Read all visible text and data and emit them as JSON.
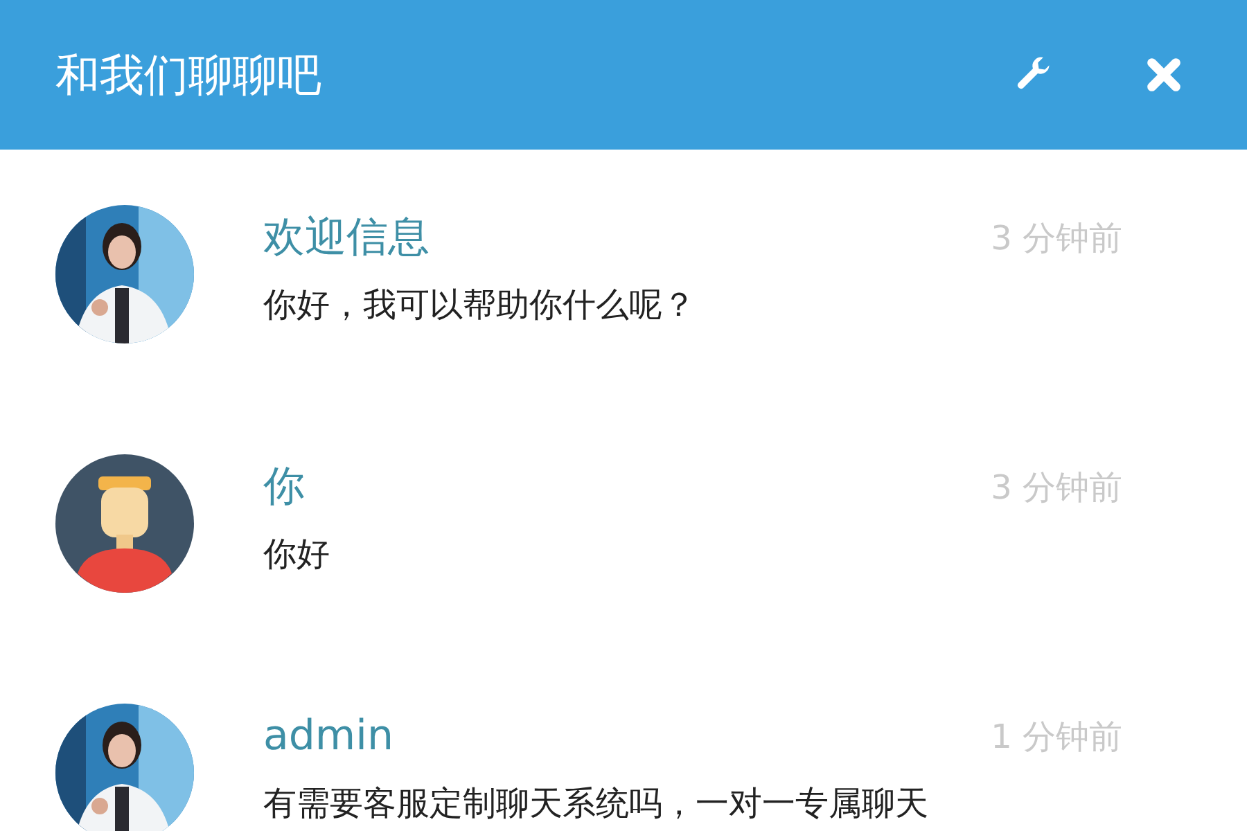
{
  "header": {
    "title": "和我们聊聊吧"
  },
  "messages": [
    {
      "name": "欢迎信息",
      "time": "3 分钟前",
      "text": "你好，我可以帮助你什么呢？"
    },
    {
      "avatar": {
        "kind": "cartoon"
      },
      "name": "你",
      "time": "3 分钟前",
      "text": "你好"
    },
    {
      "name": "admin",
      "time": "1 分钟前",
      "text": "有需要客服定制聊天系统吗，一对一专属聊天"
    }
  ]
}
